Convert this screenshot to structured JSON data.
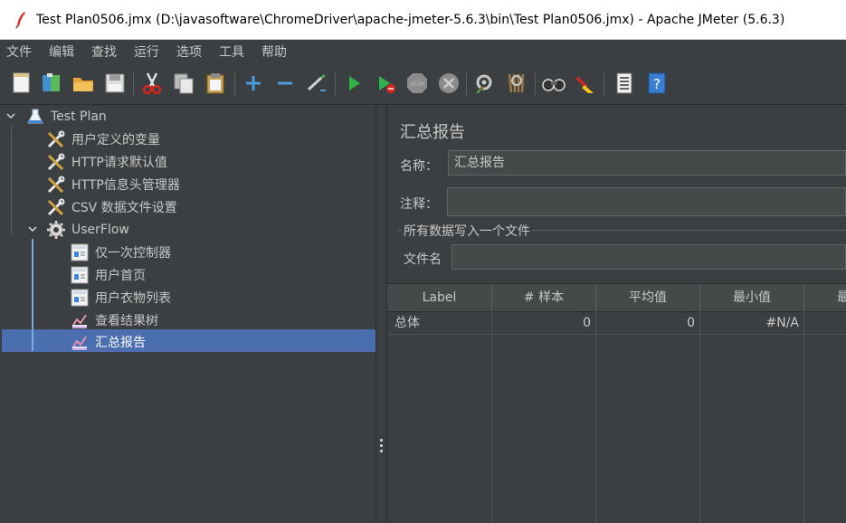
{
  "window": {
    "title": "Test Plan0506.jmx (D:\\javasoftware\\ChromeDriver\\apache-jmeter-5.6.3\\bin\\Test Plan0506.jmx) - Apache JMeter (5.6.3)",
    "icon": "jmeter-feather-icon"
  },
  "menu": [
    "文件",
    "编辑",
    "查找",
    "运行",
    "选项",
    "工具",
    "帮助"
  ],
  "toolbar": [
    {
      "name": "new-icon"
    },
    {
      "name": "templates-icon"
    },
    {
      "name": "open-icon"
    },
    {
      "name": "save-icon"
    },
    {
      "name": "cut-icon"
    },
    {
      "name": "copy-icon"
    },
    {
      "name": "paste-icon"
    },
    {
      "name": "expand-icon"
    },
    {
      "name": "collapse-icon"
    },
    {
      "name": "toggle-icon"
    },
    {
      "name": "start-icon"
    },
    {
      "name": "start-no-pause-icon"
    },
    {
      "name": "stop-icon"
    },
    {
      "name": "shutdown-icon"
    },
    {
      "name": "clear-icon"
    },
    {
      "name": "clear-all-icon"
    },
    {
      "name": "search-icon"
    },
    {
      "name": "reset-search-icon"
    },
    {
      "name": "function-helper-icon"
    },
    {
      "name": "help-icon"
    }
  ],
  "tree": {
    "items": [
      {
        "label": "Test Plan",
        "icon": "test-plan-flask-icon"
      },
      {
        "label": "用户定义的变量",
        "icon": "config-element-icon"
      },
      {
        "label": "HTTP请求默认值",
        "icon": "config-element-icon"
      },
      {
        "label": "HTTP信息头管理器",
        "icon": "config-element-icon"
      },
      {
        "label": "CSV 数据文件设置",
        "icon": "config-element-icon"
      },
      {
        "label": "UserFlow",
        "icon": "thread-group-gear-icon"
      },
      {
        "label": "仅一次控制器",
        "icon": "controller-icon"
      },
      {
        "label": "用户首页",
        "icon": "controller-icon"
      },
      {
        "label": "用户衣物列表",
        "icon": "controller-icon"
      },
      {
        "label": "查看结果树",
        "icon": "listener-icon"
      },
      {
        "label": "汇总报告",
        "icon": "listener-icon"
      }
    ],
    "selected": "汇总报告"
  },
  "panel": {
    "title": "汇总报告",
    "name_label": "名称：",
    "name_value": "汇总报告",
    "comment_label": "注释：",
    "comment_value": "",
    "file_group_title": "所有数据写入一个文件",
    "filename_label": "文件名",
    "filename_value": ""
  },
  "table": {
    "columns": [
      "Label",
      "# 样本",
      "平均值",
      "最小值",
      "最"
    ],
    "rows": [
      {
        "label": "总体",
        "samples": "0",
        "average": "0",
        "min": "#N/A",
        "max": ""
      }
    ]
  }
}
